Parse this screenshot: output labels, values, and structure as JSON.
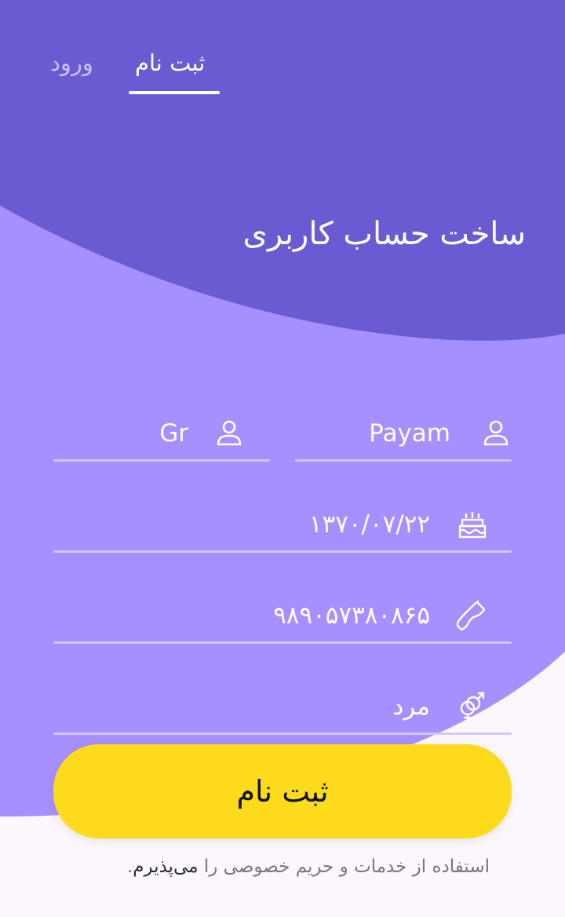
{
  "tabs": {
    "signup_label": "ثبت نام",
    "login_label": "ورود",
    "active": "signup"
  },
  "page_title": "ساخت حساب کاربری",
  "form": {
    "first_name": "Payam",
    "last_name": "Gr",
    "birth_date": "۱۳۷۰/۰۷/۲۲",
    "phone": "۹۸۹۰۵۷۳۸۰۸۶۵",
    "gender": "مرد"
  },
  "submit_label": "ثبت نام",
  "terms": {
    "prefix": "استفاده از خدمات و حریم خصوصی را ",
    "link": "می‌پذیرم",
    "suffix": "."
  },
  "colors": {
    "header": "#6a5bd3",
    "form_bg": "#a690ff",
    "page_bg": "#fbf7fd",
    "button": "#fdda1c"
  },
  "icons": {
    "first_name": "user-icon",
    "last_name": "user-icon",
    "birth_date": "birthday-cake-icon",
    "phone": "phone-icon",
    "gender": "gender-icon"
  }
}
